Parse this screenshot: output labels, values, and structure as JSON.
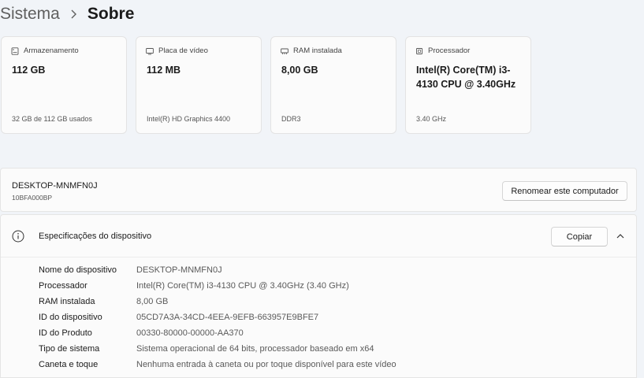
{
  "breadcrumb": {
    "parent": "Sistema",
    "current": "Sobre"
  },
  "cards": [
    {
      "icon": "storage-icon",
      "label": "Armazenamento",
      "value": "112 GB",
      "sub": "32 GB de 112 GB usados"
    },
    {
      "icon": "gpu-icon",
      "label": "Placa de vídeo",
      "value": "112 MB",
      "sub": "Intel(R) HD Graphics 4400"
    },
    {
      "icon": "ram-icon",
      "label": "RAM instalada",
      "value": "8,00 GB",
      "sub": "DDR3"
    },
    {
      "icon": "cpu-icon",
      "label": "Processador",
      "value": "Intel(R) Core(TM) i3-4130 CPU @ 3.40GHz",
      "sub": "3.40 GHz"
    }
  ],
  "device": {
    "name": "DESKTOP-MNMFN0J",
    "model": "10BFA000BP",
    "rename_label": "Renomear este computador"
  },
  "specs": {
    "title": "Especificações do dispositivo",
    "copy_label": "Copiar",
    "rows": [
      {
        "label": "Nome do dispositivo",
        "value": "DESKTOP-MNMFN0J"
      },
      {
        "label": "Processador",
        "value": "Intel(R) Core(TM) i3-4130 CPU @ 3.40GHz (3.40 GHz)"
      },
      {
        "label": "RAM instalada",
        "value": "8,00 GB"
      },
      {
        "label": "ID do dispositivo",
        "value": "05CD7A3A-34CD-4EEA-9EFB-663957E9BFE7"
      },
      {
        "label": "ID do Produto",
        "value": "00330-80000-00000-AA370"
      },
      {
        "label": "Tipo de sistema",
        "value": "Sistema operacional de 64 bits, processador baseado em x64"
      },
      {
        "label": "Caneta e toque",
        "value": "Nenhuma entrada à caneta ou por toque disponível para este vídeo"
      }
    ]
  }
}
